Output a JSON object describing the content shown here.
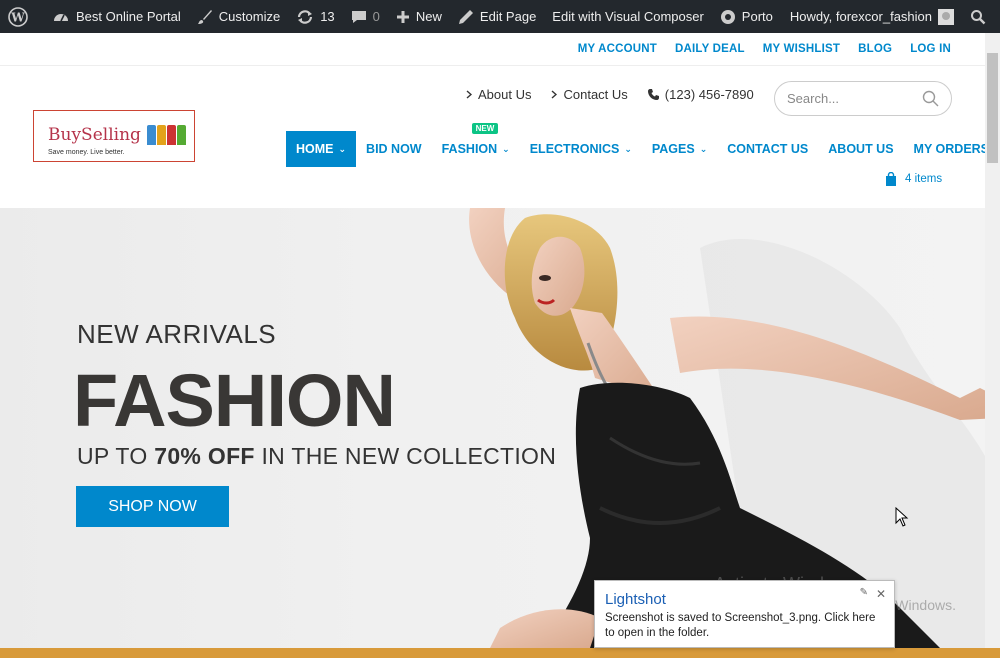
{
  "admin_bar": {
    "site_name": "Best Online Portal",
    "customize": "Customize",
    "updates_count": "13",
    "comments_count": "0",
    "new": "New",
    "edit_page": "Edit Page",
    "visual_composer": "Edit with Visual Composer",
    "theme": "Porto",
    "greeting": "Howdy, forexcor_fashion"
  },
  "top_links": [
    "MY ACCOUNT",
    "DAILY DEAL",
    "MY WISHLIST",
    "BLOG",
    "LOG IN"
  ],
  "logo": {
    "name": "BuySelling",
    "tagline": "Save money. Live better."
  },
  "contact": {
    "about": "About Us",
    "contact": "Contact Us",
    "phone": "(123) 456-7890"
  },
  "search": {
    "placeholder": "Search..."
  },
  "nav": [
    {
      "label": "HOME"
    },
    {
      "label": "BID NOW"
    },
    {
      "label": "FASHION"
    },
    {
      "label": "ELECTRONICS"
    },
    {
      "label": "PAGES"
    },
    {
      "label": "CONTACT US"
    },
    {
      "label": "ABOUT US"
    },
    {
      "label": "MY ORDERS"
    }
  ],
  "nav_badge": "NEW",
  "cart": {
    "label": "4 items"
  },
  "hero": {
    "subtitle": "NEW ARRIVALS",
    "title": "FASHION",
    "offer_prefix": "UP TO",
    "offer_bold": "70% OFF",
    "offer_suffix": "IN THE NEW COLLECTION",
    "button": "SHOP NOW"
  },
  "activate_windows": {
    "line1": "Activate Windows",
    "line2": "Go to PC settings to activate Windows."
  },
  "toast": {
    "title": "Lightshot",
    "body": "Screenshot is saved to Screenshot_3.png. Click here to open in the folder."
  },
  "colors": {
    "accent": "#0088cc",
    "admin_bar": "#23282d",
    "badge": "#0cc485"
  }
}
